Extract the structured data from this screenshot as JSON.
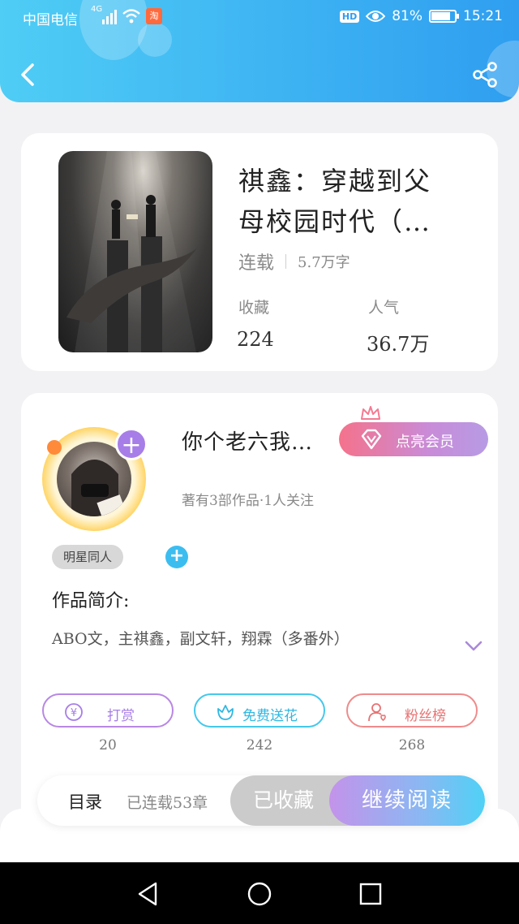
{
  "status_bar": {
    "carrier": "中国电信",
    "network": "4G",
    "battery": "81%",
    "battery_level": 0.81,
    "time": "15:21",
    "hd_badge": "HD"
  },
  "colors": {
    "header_start": "#4fcdf5",
    "header_end": "#2f9ef0",
    "accent_purple": "#a77ee8",
    "accent_blue": "#3cbdf0",
    "reward_color": "#b07fe0",
    "flower_color": "#33c3e8",
    "fans_color": "#ef7e7e"
  },
  "book": {
    "title": "祺鑫：穿越到父母校园时代（…",
    "status": "连载",
    "word_count": "5.7万字",
    "favorites_label": "收藏",
    "favorites_value": "224",
    "popularity_label": "人气",
    "popularity_value": "36.7万"
  },
  "author": {
    "name": "你个老六我…",
    "vip_button": "点亮会员",
    "stats": "著有3部作品·1人关注",
    "tag": "明星同人"
  },
  "intro": {
    "title": "作品简介:",
    "text": "ABO文，主祺鑫，副文轩，翔霖（多番外）"
  },
  "actions": [
    {
      "label": "打赏",
      "count": "20",
      "icon": "reward-icon"
    },
    {
      "label": "免费送花",
      "count": "242",
      "icon": "flower-icon"
    },
    {
      "label": "粉丝榜",
      "count": "268",
      "icon": "fans-icon"
    }
  ],
  "reading_bar": {
    "toc_label": "目录",
    "chapters": "已连载53章",
    "collected_label": "已收藏",
    "continue_label": "继续阅读"
  },
  "nav": {
    "back": "back-triangle-icon",
    "home": "home-circle-icon",
    "recents": "recents-square-icon"
  }
}
